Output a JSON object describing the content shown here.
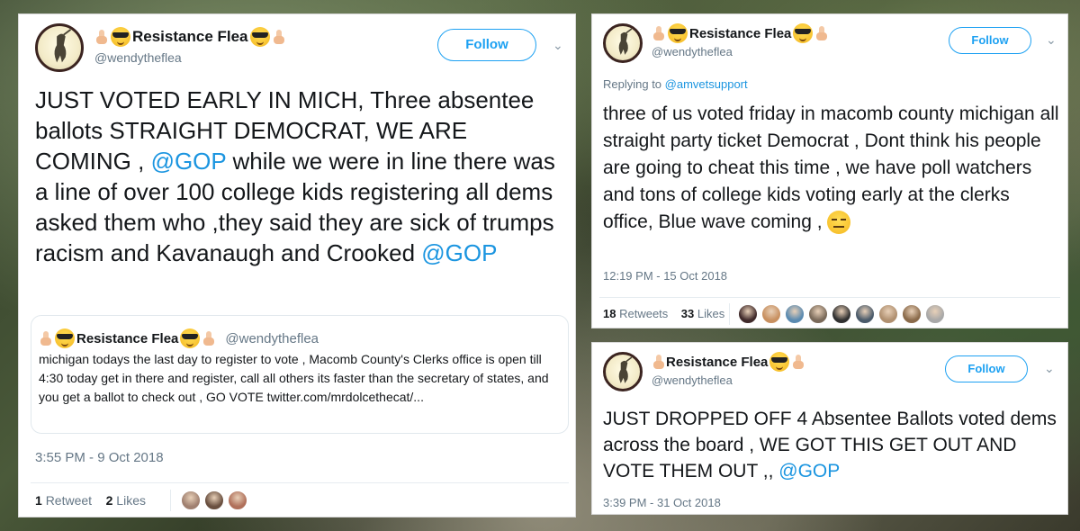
{
  "tweet_left": {
    "display_name": "Resistance Flea",
    "handle": "@wendytheflea",
    "follow_label": "Follow",
    "text_parts": [
      "JUST VOTED EARLY IN MICH, Three absentee ballots STRAIGHT DEMOCRAT, WE ARE COMING ,  ",
      "@GOP",
      "  while we were in line there was a line of over  100 college kids registering all dems asked them who ,they said they are sick of trumps racism and Kavanaugh and Crooked ",
      "@GOP"
    ],
    "quote": {
      "display_name": "Resistance Flea",
      "handle": "@wendytheflea",
      "text": "michigan todays the last day to register to vote , Macomb County's Clerks office is open till 4:30 today get in there and register, call all others its faster than the secretary of states, and you get a ballot to check out , GO VOTE twitter.com/mrdolcethecat/..."
    },
    "timestamp": "3:55 PM - 9 Oct 2018",
    "retweets_count": "1",
    "retweets_label": "Retweet",
    "likes_count": "2",
    "likes_label": "Likes",
    "liker_colors": [
      "#a08070",
      "#6a5040",
      "#b0705a"
    ]
  },
  "tweet_top_right": {
    "display_name": "Resistance Flea",
    "handle": "@wendytheflea",
    "follow_label": "Follow",
    "replying_label": "Replying to ",
    "replying_to": "@amvetsupport",
    "text": "three of us voted friday in macomb county michigan all straight party ticket Democrat , Dont think his people are going to cheat this time , we have poll watchers and tons of college kids voting early at the clerks office, Blue wave coming ,",
    "timestamp": "12:19 PM - 15 Oct 2018",
    "retweets_count": "18",
    "retweets_label": "Retweets",
    "likes_count": "33",
    "likes_label": "Likes",
    "liker_colors": [
      "#402a2a",
      "#c89060",
      "#5a8ab0",
      "#7a6a5a",
      "#303030",
      "#4a5a6a",
      "#b09070",
      "#8a6a4a",
      "#a8a8a8"
    ]
  },
  "tweet_bottom_right": {
    "display_name": "Resistance Flea",
    "handle": "@wendytheflea",
    "follow_label": "Follow",
    "text_parts": [
      "JUST DROPPED OFF 4 Absentee Ballots voted dems across the board , WE GOT THIS GET OUT AND VOTE THEM OUT ,, ",
      "@GOP"
    ],
    "timestamp": "3:39 PM - 31 Oct 2018"
  }
}
